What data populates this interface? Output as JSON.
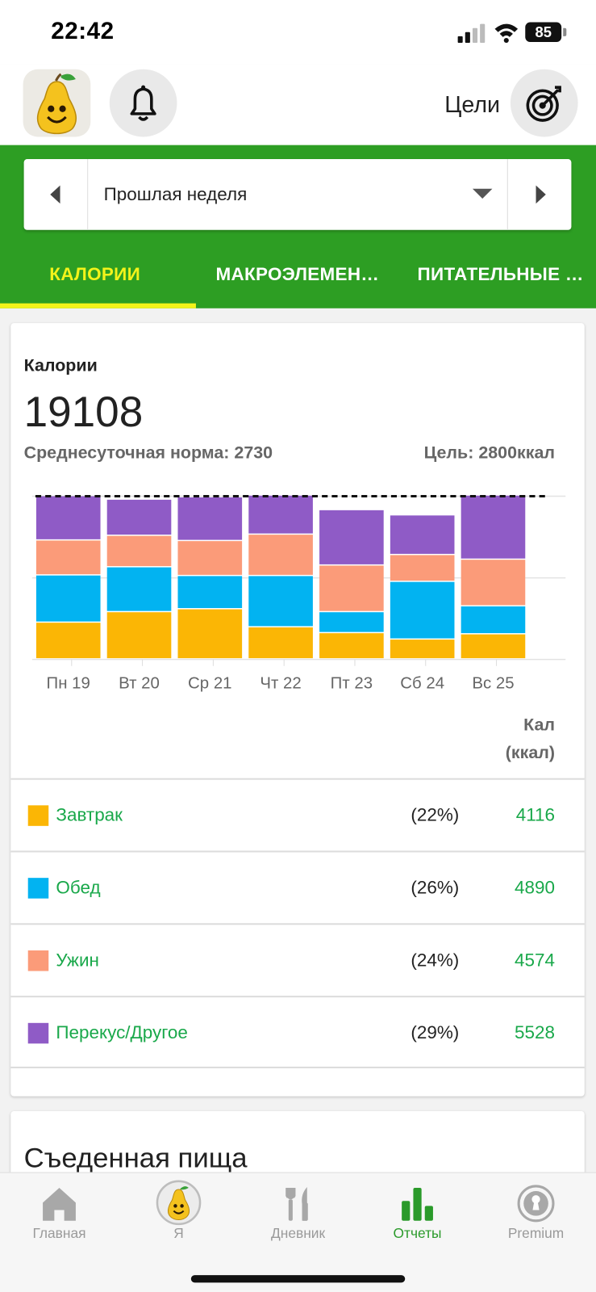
{
  "status_bar": {
    "time": "22:42",
    "battery": "85"
  },
  "header": {
    "goals_label": "Цели"
  },
  "period": {
    "label": "Прошлая неделя"
  },
  "tabs": [
    {
      "label": "КАЛОРИИ",
      "active": true
    },
    {
      "label": "МАКРОЭЛЕМЕН…",
      "active": false
    },
    {
      "label": "ПИТАТЕЛЬНЫЕ …",
      "active": false
    }
  ],
  "summary": {
    "title": "Калории",
    "total": "19108",
    "average": "Среднесуточная норма: 2730",
    "goal": "Цель: 2800ккал",
    "unit_line1": "Кал",
    "unit_line2": "(ккал)"
  },
  "colors": {
    "breakfast": "#fbb605",
    "lunch": "#02b3f1",
    "dinner": "#fb9b79",
    "snack": "#8f5bc6",
    "accent_green": "#2d9e23",
    "tab_active": "#f3f31a"
  },
  "chart_data": {
    "type": "bar",
    "stacked": true,
    "categories": [
      "Пн 19",
      "Вт 20",
      "Ср 21",
      "Чт 22",
      "Пт 23",
      "Сб 24",
      "Вс 25"
    ],
    "series": [
      {
        "name": "Завтрак",
        "color": "#fbb605",
        "values": [
          630,
          810,
          860,
          550,
          450,
          340,
          430
        ]
      },
      {
        "name": "Обед",
        "color": "#02b3f1",
        "values": [
          810,
          770,
          570,
          880,
          360,
          990,
          480
        ]
      },
      {
        "name": "Ужин",
        "color": "#fb9b79",
        "values": [
          600,
          540,
          600,
          710,
          800,
          460,
          800
        ]
      },
      {
        "name": "Перекус/Другое",
        "color": "#8f5bc6",
        "values": [
          760,
          620,
          750,
          670,
          950,
          680,
          1100
        ]
      }
    ],
    "goal_line": 2800,
    "ylim": [
      0,
      2800
    ],
    "grid": true,
    "legend": "below"
  },
  "breakdown": [
    {
      "name": "Завтрак",
      "pct": "(22%)",
      "value": "4116",
      "color": "#fbb605"
    },
    {
      "name": "Обед",
      "pct": "(26%)",
      "value": "4890",
      "color": "#02b3f1"
    },
    {
      "name": "Ужин",
      "pct": "(24%)",
      "value": "4574",
      "color": "#fb9b79"
    },
    {
      "name": "Перекус/Другое",
      "pct": "(29%)",
      "value": "5528",
      "color": "#8f5bc6"
    }
  ],
  "food_card": {
    "title": "Съеденная пища"
  },
  "bottom_nav": [
    {
      "label": "Главная",
      "icon": "home-icon",
      "active": false
    },
    {
      "label": "Я",
      "icon": "pear-avatar-icon",
      "active": false
    },
    {
      "label": "Дневник",
      "icon": "fork-knife-icon",
      "active": false
    },
    {
      "label": "Отчеты",
      "icon": "bar-chart-icon",
      "active": true
    },
    {
      "label": "Premium",
      "icon": "premium-badge-icon",
      "active": false
    }
  ]
}
